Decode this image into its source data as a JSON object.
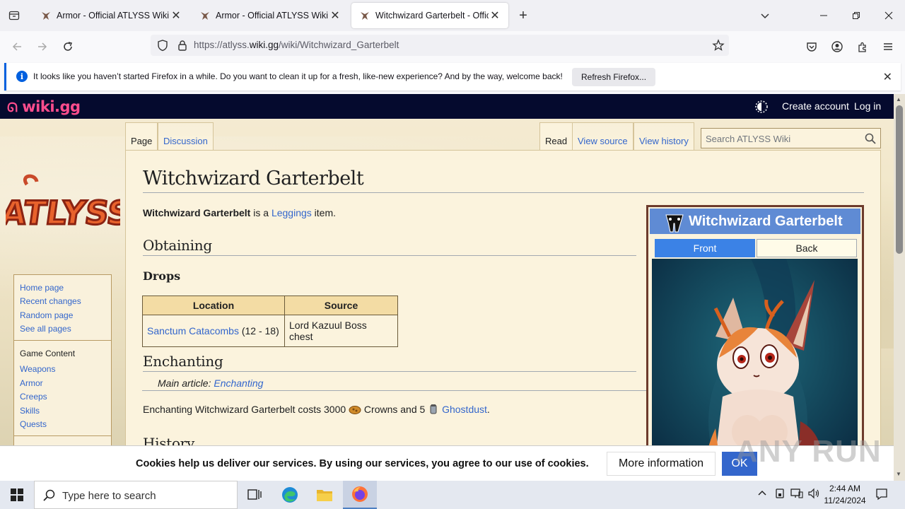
{
  "browser": {
    "tabs": [
      {
        "title": "Armor - Official ATLYSS Wiki",
        "active": false
      },
      {
        "title": "Armor - Official ATLYSS Wiki",
        "active": false
      },
      {
        "title": "Witchwizard Garterbelt - Offici",
        "active": true
      }
    ],
    "url_prefix": "https://atlyss.",
    "url_domain": "wiki.gg",
    "url_path": "/wiki/Witchwizard_Garterbelt",
    "notification": {
      "message": "It looks like you haven’t started Firefox in a while. Do you want to clean it up for a fresh, like-new experience? And by the way, welcome back!",
      "button": "Refresh Firefox..."
    }
  },
  "wiki": {
    "logo": "wiki.gg",
    "create_account": "Create account",
    "log_in": "Log in",
    "site_logo": "ATLYSS",
    "tabs": {
      "page": "Page",
      "discussion": "Discussion",
      "read": "Read",
      "view_source": "View source",
      "view_history": "View history"
    },
    "search_placeholder": "Search ATLYSS Wiki",
    "sidebar": {
      "nav": [
        "Home page",
        "Recent changes",
        "Random page",
        "See all pages"
      ],
      "game_content_heading": "Game Content",
      "game_content": [
        "Weapons",
        "Armor",
        "Creeps",
        "Skills",
        "Quests"
      ]
    }
  },
  "article": {
    "title": "Witchwizard Garterbelt",
    "intro_bold": "Witchwizard Garterbelt",
    "intro_mid": " is a ",
    "intro_link": "Leggings",
    "intro_end": " item.",
    "h_obtaining": "Obtaining",
    "h_drops": "Drops",
    "table": {
      "headers": [
        "Location",
        "Source"
      ],
      "rows": [
        {
          "location_link": "Sanctum Catacombs",
          "location_range": " (12 - 18)",
          "source": "Lord Kazuul Boss chest"
        }
      ]
    },
    "h_enchanting": "Enchanting",
    "hatnote_prefix": "Main article: ",
    "hatnote_link": "Enchanting",
    "enchant_text_1": "Enchanting Witchwizard Garterbelt costs 3000 ",
    "enchant_text_2": " Crowns and 5 ",
    "enchant_link": "Ghostdust",
    "enchant_end": ".",
    "h_history": "History"
  },
  "infobox": {
    "title": "Witchwizard Garterbelt",
    "tab_front": "Front",
    "tab_back": "Back"
  },
  "cookies": {
    "text": "Cookies help us deliver our services. By using our services, you agree to our use of cookies.",
    "more": "More information",
    "ok": "OK"
  },
  "watermark": "ANY RUN",
  "taskbar": {
    "search_placeholder": "Type here to search",
    "time": "2:44 AM",
    "date": "11/24/2024"
  },
  "colors": {
    "accent_link": "#3366cc",
    "wiki_header": "#050a2e",
    "infobox_title": "#5f8bd4",
    "firefox_blue": "#0060df"
  }
}
